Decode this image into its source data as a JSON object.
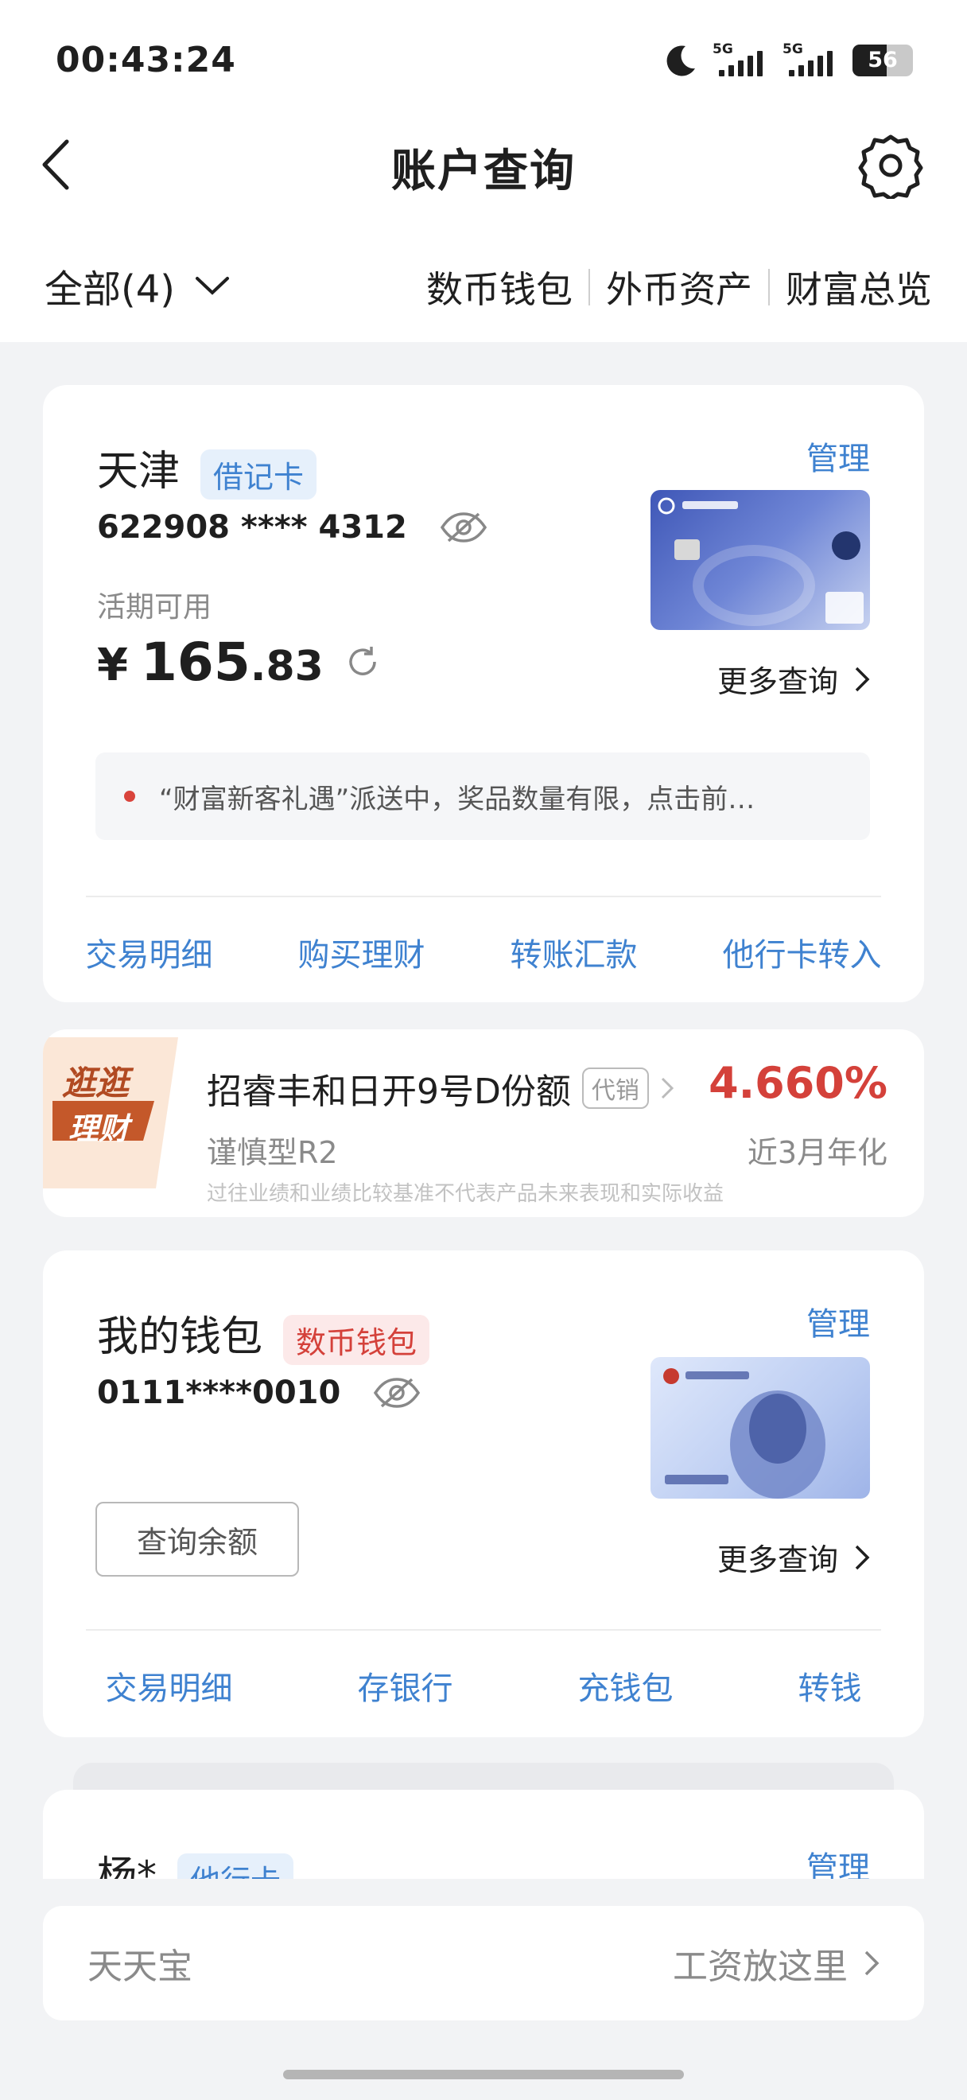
{
  "status_bar": {
    "time": "00:43:24",
    "signal1": "5G",
    "signal2": "5G",
    "battery": "56"
  },
  "header": {
    "title": "账户查询"
  },
  "filter": {
    "label": "全部(4)"
  },
  "tabs": [
    "数币钱包",
    "外币资产",
    "财富总览"
  ],
  "card1": {
    "name": "天津",
    "tag": "借记卡",
    "manage": "管理",
    "number": "622908 **** 4312",
    "balance_label": "活期可用",
    "currency": "¥",
    "balance_int": "165",
    "balance_dec": ".83",
    "more": "更多查询",
    "notice": "“财富新客礼遇”派送中，奖品数量有限，点击前…",
    "actions": [
      "交易明细",
      "购买理财",
      "转账汇款",
      "他行卡转入"
    ]
  },
  "promo": {
    "badge_line1": "逛逛",
    "badge_line2": "理财",
    "product": "招睿丰和日开9号D份额",
    "tag": "代销",
    "rate": "4.660%",
    "risk": "谨慎型R2",
    "rate_label": "近3月年化",
    "disclaimer": "过往业绩和业绩比较基准不代表产品未来表现和实际收益"
  },
  "card2": {
    "name": "我的钱包",
    "tag": "数币钱包",
    "manage": "管理",
    "number": "0111****0010",
    "query_button": "查询余额",
    "more": "更多查询",
    "actions": [
      "交易明细",
      "存银行",
      "充钱包",
      "转钱"
    ]
  },
  "card3": {
    "name": "杨*",
    "tag": "他行卡",
    "manage": "管理"
  },
  "bottom": {
    "left": "天天宝",
    "right": "工资放这里"
  },
  "colors": {
    "accent": "#3f82d0",
    "red": "#d4413a"
  }
}
